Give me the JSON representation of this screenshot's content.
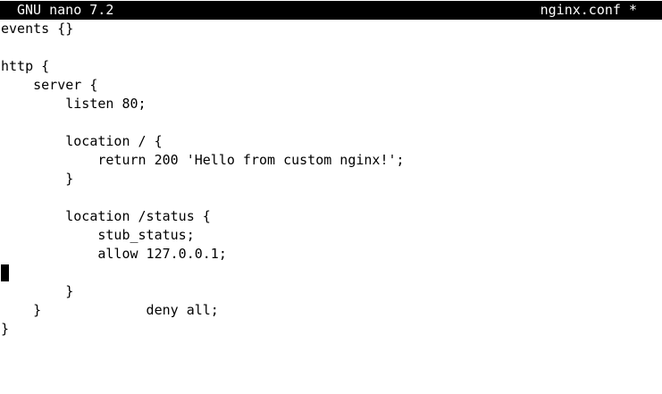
{
  "titlebar": {
    "app": "GNU nano 7.2",
    "filename": "nginx.conf *"
  },
  "editor": {
    "lines": [
      "events {}",
      "",
      "http {",
      "    server {",
      "        listen 80;",
      "",
      "        location / {",
      "            return 200 'Hello from custom nginx!';",
      "        }",
      "",
      "        location /status {",
      "            stub_status;",
      "            allow 127.0.0.1;",
      "            deny all;",
      "        }",
      "    }",
      "}"
    ],
    "cursor_line": 13
  }
}
